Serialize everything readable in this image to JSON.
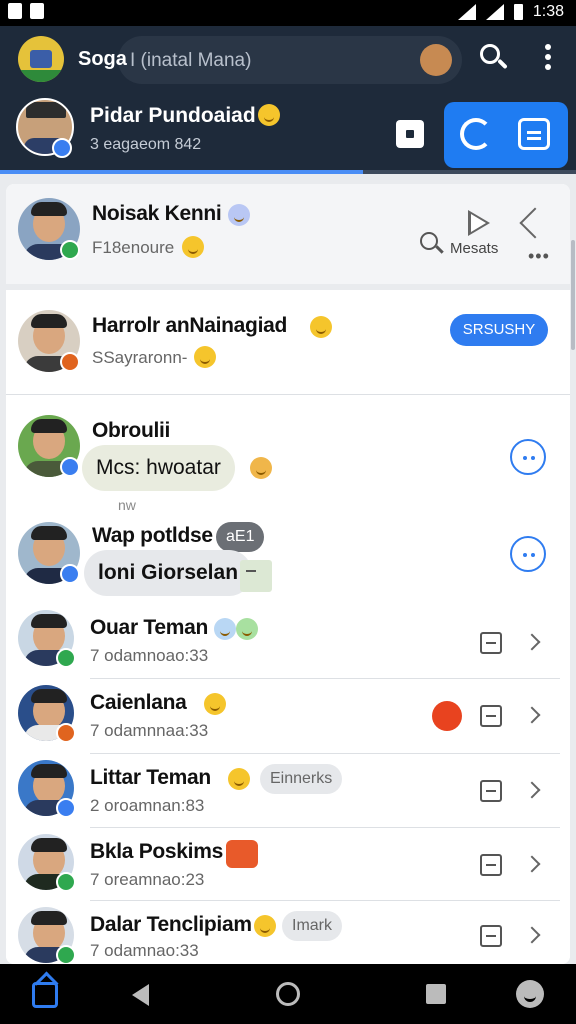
{
  "status_bar": {
    "time": "1:38"
  },
  "app_bar": {
    "title": "Soga",
    "search_placeholder": "I (inatal Mana)"
  },
  "profile": {
    "name": "Pidar Pundoaiad",
    "subtitle": "3 eagaeom 842",
    "progress": 0.63
  },
  "chats": [
    {
      "name": "Noisak Kenni",
      "subtitle": "F18enoure",
      "action_label": "Mesats"
    },
    {
      "name": "Harrolr anNainagiad",
      "subtitle": "SSayraronn-",
      "button_label": "SRSUSHY"
    },
    {
      "name": "Obroulii",
      "bubble": "Mcs: hwoatar",
      "note": "nw"
    },
    {
      "name": "Wap potldse",
      "tag": "aE1",
      "bubble": "loni Giorselan"
    },
    {
      "name": "Ouar Teman",
      "subtitle": "7 odamnoao:33"
    },
    {
      "name": "Caienlana",
      "subtitle": "7 odamnnaa:33"
    },
    {
      "name": "Littar Teman",
      "subtitle": "2 oroamnan:83",
      "chip": "Einnerks"
    },
    {
      "name": "Bkla Poskims",
      "subtitle": "7 oreamnao:23"
    },
    {
      "name": "Dalar Tenclipiam",
      "subtitle": "7 odamnao:33",
      "chip": "Imark"
    }
  ],
  "colors": {
    "header_bg": "#1e2a3a",
    "accent": "#2f7cf0",
    "online": "#2fa84f",
    "away": "#e0641f"
  }
}
